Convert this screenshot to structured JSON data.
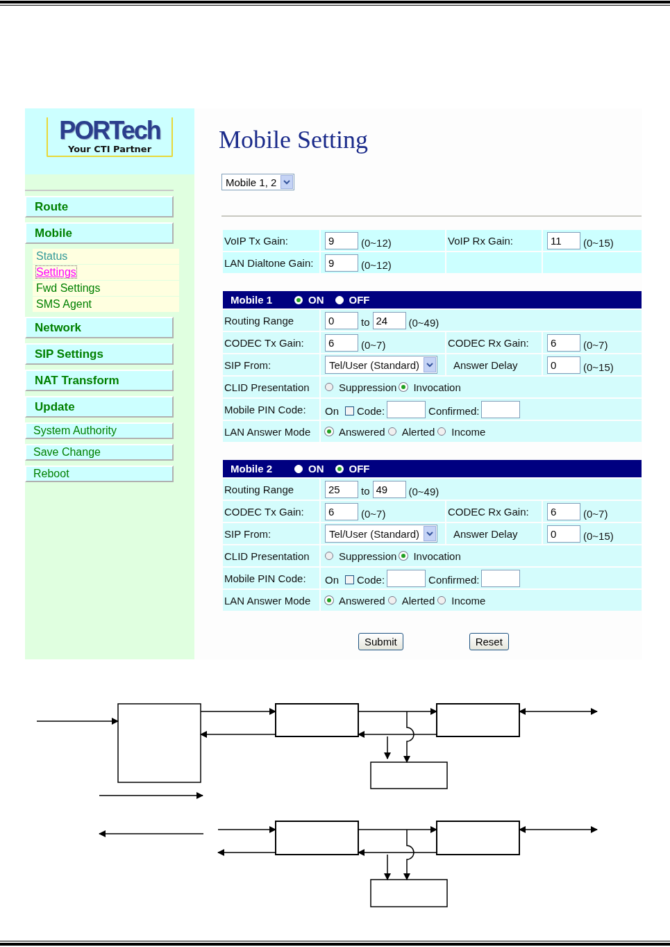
{
  "logo": {
    "name": "PORTech",
    "tagline": "Your CTI Partner"
  },
  "menu": [
    {
      "label": "Route",
      "kind": "section"
    },
    {
      "label": "Mobile",
      "kind": "section",
      "children": [
        {
          "label": "Status",
          "selected": false,
          "visited": true
        },
        {
          "label": "Settings",
          "selected": true,
          "visited": false
        },
        {
          "label": "Fwd Settings",
          "selected": false,
          "visited": false
        },
        {
          "label": "SMS Agent",
          "selected": false,
          "visited": false
        }
      ]
    },
    {
      "label": "Network",
      "kind": "section"
    },
    {
      "label": "SIP Settings",
      "kind": "section"
    },
    {
      "label": "NAT Transform",
      "kind": "section"
    },
    {
      "label": "Update",
      "kind": "section"
    },
    {
      "label": "System Authority",
      "kind": "link"
    },
    {
      "label": "Save Change",
      "kind": "link"
    },
    {
      "label": "Reboot",
      "kind": "link"
    }
  ],
  "title": "Mobile Setting",
  "mobile_select": {
    "value": "Mobile 1, 2"
  },
  "gains": [
    [
      {
        "label": "VoIP Tx Gain:",
        "value": "9",
        "range": "(0~12)"
      },
      {
        "label": "VoIP Rx Gain:",
        "value": "11",
        "range": "(0~15)"
      }
    ],
    [
      {
        "label": "LAN Dialtone Gain:",
        "value": "9",
        "range": "(0~12)"
      }
    ]
  ],
  "mobiles": [
    {
      "title": "Mobile 1",
      "power": [
        {
          "label": "ON",
          "selected": true
        },
        {
          "label": "OFF",
          "selected": false
        }
      ],
      "routing": {
        "label": "Routing Range",
        "from": "0",
        "to_label": "to",
        "to": "24",
        "range": "(0~49)"
      },
      "codec_tx": {
        "label": "CODEC Tx Gain:",
        "value": "6",
        "range": "(0~7)"
      },
      "codec_rx": {
        "label": "CODEC Rx Gain:",
        "value": "6",
        "range": "(0~7)"
      },
      "sip_from": {
        "label": "SIP From:",
        "value": "Tel/User (Standard)"
      },
      "answer_delay": {
        "label": "Answer Delay",
        "value": "0",
        "range": "(0~15)"
      },
      "clid": {
        "label": "CLID Presentation",
        "options": [
          {
            "label": "Suppression",
            "selected": false
          },
          {
            "label": "Invocation",
            "selected": true
          }
        ]
      },
      "pin": {
        "label": "Mobile PIN Code:",
        "on_label": "On",
        "checked": false,
        "code_label": "Code:",
        "confirmed_label": "Confirmed:"
      },
      "answer_mode": {
        "label": "LAN Answer Mode",
        "options": [
          {
            "label": "Answered",
            "selected": true
          },
          {
            "label": "Alerted",
            "selected": false
          },
          {
            "label": "Income",
            "selected": false
          }
        ]
      }
    },
    {
      "title": "Mobile 2",
      "power": [
        {
          "label": "ON",
          "selected": false
        },
        {
          "label": "OFF",
          "selected": true
        }
      ],
      "routing": {
        "label": "Routing Range",
        "from": "25",
        "to_label": "to",
        "to": "49",
        "range": "(0~49)"
      },
      "codec_tx": {
        "label": "CODEC Tx Gain:",
        "value": "6",
        "range": "(0~7)"
      },
      "codec_rx": {
        "label": "CODEC Rx Gain:",
        "value": "6",
        "range": "(0~7)"
      },
      "sip_from": {
        "label": "SIP From:",
        "value": "Tel/User (Standard)"
      },
      "answer_delay": {
        "label": "Answer Delay",
        "value": "0",
        "range": "(0~15)"
      },
      "clid": {
        "label": "CLID Presentation",
        "options": [
          {
            "label": "Suppression",
            "selected": false
          },
          {
            "label": "Invocation",
            "selected": true
          }
        ]
      },
      "pin": {
        "label": "Mobile PIN Code:",
        "on_label": "On",
        "checked": false,
        "code_label": "Code:",
        "confirmed_label": "Confirmed:"
      },
      "answer_mode": {
        "label": "LAN Answer Mode",
        "options": [
          {
            "label": "Answered",
            "selected": true
          },
          {
            "label": "Alerted",
            "selected": false
          },
          {
            "label": "Income",
            "selected": false
          }
        ]
      }
    }
  ],
  "buttons": [
    "Submit",
    "Reset"
  ]
}
